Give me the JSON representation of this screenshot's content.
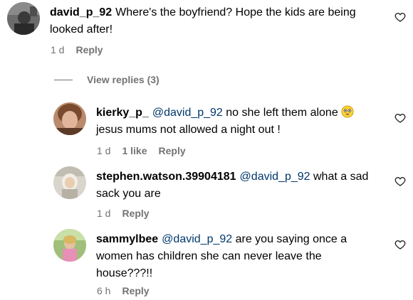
{
  "main_comment": {
    "username": "david_p_92",
    "text": "Where's the boyfriend? Hope the kids are being looked after!",
    "time": "1 d",
    "reply_label": "Reply"
  },
  "view_replies_label": "View replies (3)",
  "replies": [
    {
      "username": "kierky_p_",
      "mention": "@david_p_92",
      "text_line1": "no she left them alone",
      "emoji_name": "flushed-face-emoji",
      "text_line2": "jesus mums not allowed a night out !",
      "time": "1 d",
      "likes": "1 like",
      "reply_label": "Reply"
    },
    {
      "username": "stephen.watson.39904181",
      "mention": "@david_p_92",
      "text": "what a sad sack you are",
      "time": "1 d",
      "reply_label": "Reply"
    },
    {
      "username": "sammylbee",
      "mention": "@david_p_92",
      "text": "are you saying once a women has children she can never leave the house???!!",
      "time": "6 h",
      "reply_label": "Reply"
    }
  ],
  "colors": {
    "secondary_text": "#737373",
    "mention": "#00376b"
  }
}
